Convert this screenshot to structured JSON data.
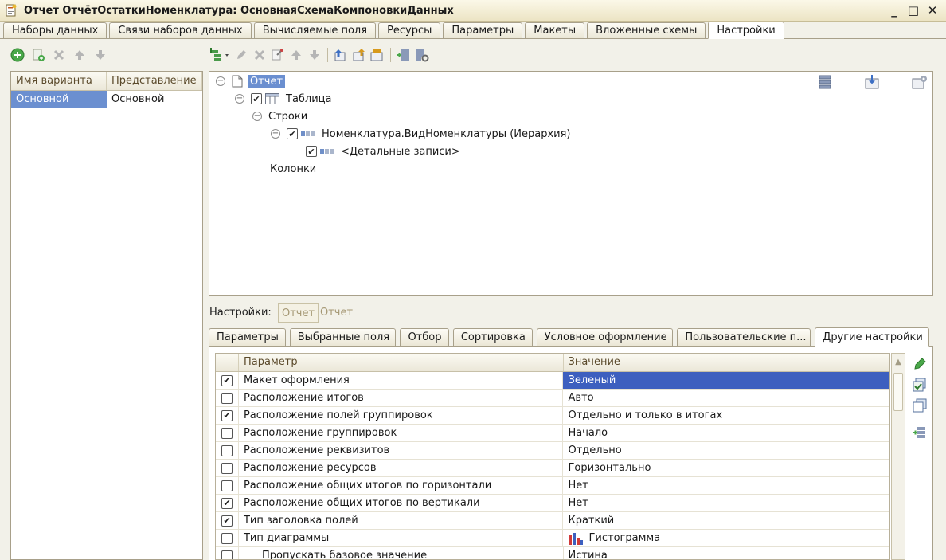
{
  "window": {
    "title": "Отчет ОтчётОстаткиНоменклатура: ОсновнаяСхемаКомпоновкиДанных",
    "controls": [
      "_",
      "□",
      "✕"
    ]
  },
  "top_tabs": [
    {
      "label": "Наборы данных"
    },
    {
      "label": "Связи наборов данных"
    },
    {
      "label": "Вычисляемые поля"
    },
    {
      "label": "Ресурсы"
    },
    {
      "label": "Параметры"
    },
    {
      "label": "Макеты"
    },
    {
      "label": "Вложенные схемы"
    },
    {
      "label": "Настройки"
    }
  ],
  "active_top_tab": "Настройки",
  "variants": {
    "columns": [
      "Имя варианта",
      "Представление"
    ],
    "rows": [
      {
        "name": "Основной",
        "presentation": "Основной"
      }
    ]
  },
  "structure": {
    "root": "Отчет",
    "table": "Таблица",
    "rows_label": "Строки",
    "group": "Номенклатура.ВидНоменклатуры (Иерархия)",
    "details": "<Детальные записи>",
    "columns_label": "Колонки"
  },
  "settings_line": {
    "label": "Настройки:",
    "chip": "Отчет",
    "text": "Отчет"
  },
  "bottom_tabs": [
    {
      "label": "Параметры"
    },
    {
      "label": "Выбранные поля"
    },
    {
      "label": "Отбор"
    },
    {
      "label": "Сортировка"
    },
    {
      "label": "Условное оформление"
    },
    {
      "label": "Пользовательские п..."
    },
    {
      "label": "Другие настройки"
    }
  ],
  "active_bottom_tab": "Другие настройки",
  "params_grid": {
    "columns": [
      "Параметр",
      "Значение"
    ],
    "rows": [
      {
        "checked": true,
        "param": "Макет оформления",
        "value": "Зеленый",
        "selected": true
      },
      {
        "checked": false,
        "param": "Расположение итогов",
        "value": "Авто"
      },
      {
        "checked": true,
        "param": "Расположение полей группировок",
        "value": "Отдельно и только в итогах"
      },
      {
        "checked": false,
        "param": "Расположение группировок",
        "value": "Начало"
      },
      {
        "checked": false,
        "param": "Расположение реквизитов",
        "value": "Отдельно"
      },
      {
        "checked": false,
        "param": "Расположение ресурсов",
        "value": "Горизонтально"
      },
      {
        "checked": false,
        "param": "Расположение общих итогов по горизонтали",
        "value": "Нет"
      },
      {
        "checked": true,
        "param": "Расположение общих итогов по вертикали",
        "value": "Нет"
      },
      {
        "checked": true,
        "param": "Тип заголовка полей",
        "value": "Краткий"
      },
      {
        "checked": false,
        "param": "Тип диаграммы",
        "value": "Гистограмма",
        "value_icon": "histogram-icon"
      },
      {
        "checked": false,
        "param": "Пропускать базовое значение",
        "value": "Истина",
        "indent": true
      }
    ]
  },
  "colors": {
    "selection": "#6b8fd0",
    "grid_selection": "#3d5fbf",
    "panel_bg": "#f2f1e9",
    "header_text": "#5b4a2b"
  }
}
